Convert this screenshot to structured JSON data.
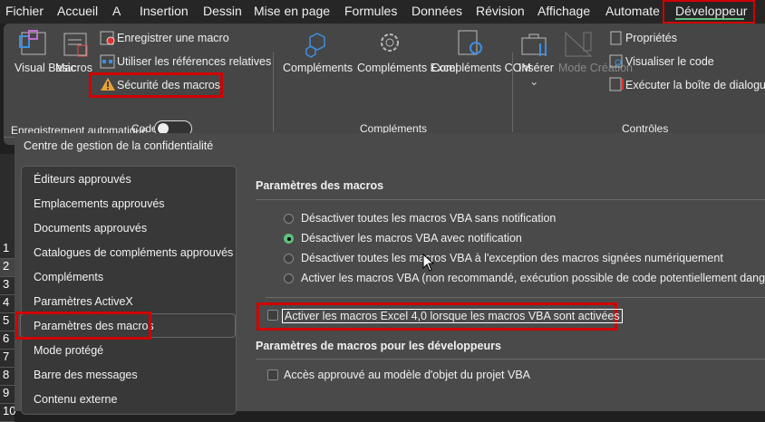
{
  "menu": {
    "tabs": [
      "Fichier",
      "Accueil",
      "A",
      "Insertion",
      "Dessin",
      "Mise en page",
      "Formules",
      "Données",
      "Révision",
      "Affichage",
      "Automate",
      "Développeur"
    ],
    "active": "Développeur"
  },
  "ribbon": {
    "code": {
      "visual_basic": "Visual Basic",
      "macros": "Macros",
      "record": "Enregistrer une macro",
      "relative": "Utiliser les références relatives",
      "security": "Sécurité des macros",
      "label": "Code"
    },
    "addins": {
      "complements": "Compléments",
      "excel": "Compléments Excel",
      "com": "Compléments COM",
      "label": "Compléments"
    },
    "controls": {
      "insert": "Insérer",
      "design": "Mode Création",
      "properties": "Propriétés",
      "view_code": "Visualiser le code",
      "run_dialog": "Exécuter la boîte de dialogue",
      "label": "Contrôles"
    },
    "qat": {
      "autosave": "Enregistrement automatique"
    }
  },
  "dialog": {
    "title": "Centre de gestion de la confidentialité",
    "sidebar": [
      "Éditeurs approuvés",
      "Emplacements approuvés",
      "Documents approuvés",
      "Catalogues de compléments approuvés",
      "Compléments",
      "Paramètres ActiveX",
      "Paramètres des macros",
      "Mode protégé",
      "Barre des messages",
      "Contenu externe"
    ],
    "selected": "Paramètres des macros",
    "macro_heading": "Paramètres des macros",
    "options": [
      "Désactiver toutes les macros VBA sans notification",
      "Désactiver les macros VBA avec notification",
      "Désactiver toutes les macros VBA à l'exception des macros signées numériquement",
      "Activer les macros VBA (non recommandé, exécution possible de code potentiellement dangereux)"
    ],
    "selected_option": 1,
    "excel4": {
      "label": "Activer les macros Excel 4,0 lorsque les macros VBA sont activées",
      "checked": false
    },
    "dev_heading": "Paramètres de macros pour les développeurs",
    "vba_access": {
      "label": "Accès approuvé au modèle d'objet du projet VBA",
      "checked": false
    }
  },
  "rows": [
    "1",
    "2",
    "3",
    "4",
    "5",
    "6",
    "7",
    "8",
    "9",
    "10"
  ],
  "colors": {
    "accent": "#5fbf7f",
    "highlight": "#d10000"
  }
}
